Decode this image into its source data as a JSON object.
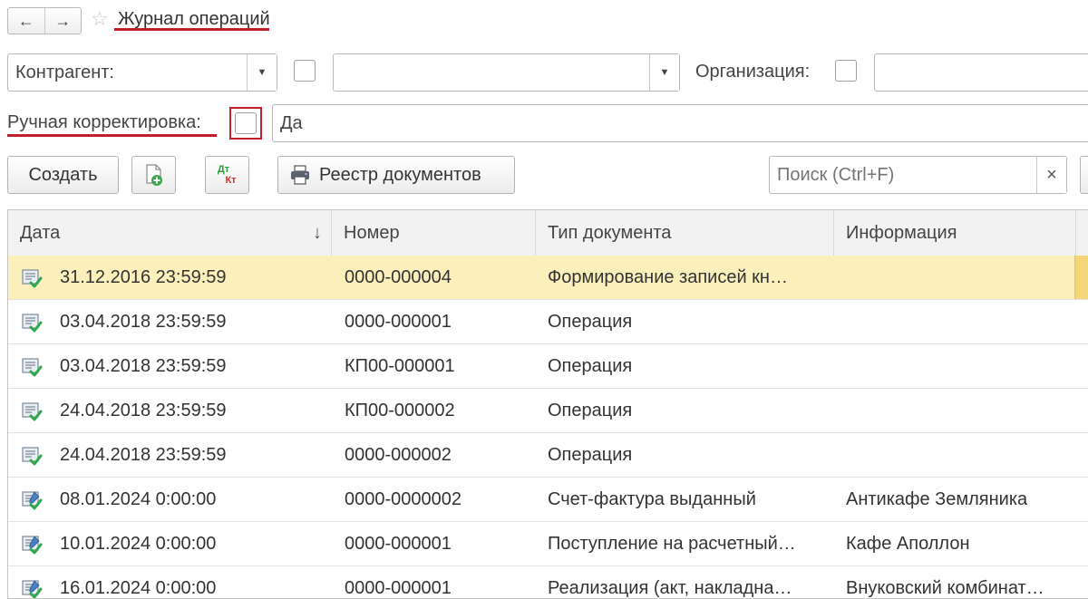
{
  "header": {
    "back_icon": "←",
    "forward_icon": "→",
    "favorite_icon": "☆",
    "title": "Журнал операций"
  },
  "filters": {
    "contragent_label": "Контрагент:",
    "contragent_value": "",
    "second_value": "",
    "organization_label": "Организация:",
    "organization_value": "",
    "manual_correction_label": "Ручная корректировка:",
    "manual_correction_value": "Да"
  },
  "toolbar": {
    "create_label": "Создать",
    "registry_label": "Реестр документов",
    "search_placeholder": "Поиск (Ctrl+F)",
    "clear_icon": "×",
    "dt_label": "Дт",
    "kt_label": "Кт"
  },
  "table": {
    "columns": [
      "Дата",
      "Номер",
      "Тип документа",
      "Информация"
    ],
    "sort_icon": "↓",
    "rows": [
      {
        "date": "31.12.2016 23:59:59",
        "number": "0000-000004",
        "type": "Формирование записей кн…",
        "info": "",
        "icon": "document-posted-icon"
      },
      {
        "date": "03.04.2018 23:59:59",
        "number": "0000-000001",
        "type": "Операция",
        "info": "",
        "icon": "document-posted-icon"
      },
      {
        "date": "03.04.2018 23:59:59",
        "number": "КП00-000001",
        "type": "Операция",
        "info": "",
        "icon": "document-posted-icon"
      },
      {
        "date": "24.04.2018 23:59:59",
        "number": "КП00-000002",
        "type": "Операция",
        "info": "",
        "icon": "document-posted-icon"
      },
      {
        "date": "24.04.2018 23:59:59",
        "number": "0000-000002",
        "type": "Операция",
        "info": "",
        "icon": "document-posted-icon"
      },
      {
        "date": "08.01.2024 0:00:00",
        "number": "0000-0000002",
        "type": "Счет-фактура выданный",
        "info": "Антикафе Земляника",
        "icon": "document-edited-posted-icon"
      },
      {
        "date": "10.01.2024 0:00:00",
        "number": "0000-000001",
        "type": "Поступление на расчетный…",
        "info": "Кафе Аполлон",
        "icon": "document-edited-posted-icon"
      },
      {
        "date": "16.01.2024 0:00:00",
        "number": "0000-000001",
        "type": "Реализация (акт, накладна…",
        "info": "Внуковский комбинат…",
        "icon": "document-edited-posted-icon"
      }
    ]
  },
  "colors": {
    "accent_red": "#c0202a",
    "selected_row": "#fbefbc",
    "check_green": "#2fa84f"
  }
}
